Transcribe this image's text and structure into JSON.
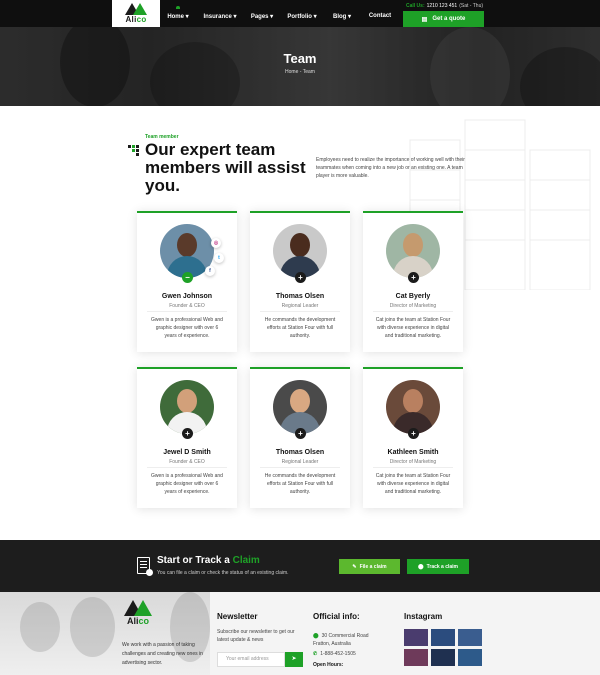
{
  "header": {
    "logo_text_a": "Ali",
    "logo_text_b": "co",
    "nav": [
      "Home",
      "Insurance",
      "Pages",
      "Portfolio",
      "Blog",
      "Contact"
    ],
    "call_label": "Call Us:",
    "call_number": "1210 123 451",
    "call_hours": "(Sat - Thu)",
    "quote_button": "Get a quote"
  },
  "hero": {
    "title": "Team",
    "breadcrumb": "Home - Team"
  },
  "intro": {
    "tag": "Team member",
    "title": "Our expert team members will assist you.",
    "description": "Employees need to realize the importance of working well with their teammates when coming into a new job or an existing one. A team player is more valuable."
  },
  "team": [
    {
      "name": "Gwen Johnson",
      "role": "Founder & CEO",
      "bio": "Gwen is a professional Web and graphic designer with over 6 years of experience."
    },
    {
      "name": "Thomas Olsen",
      "role": "Regional Leader",
      "bio": "He commands the development efforts at Station Four with full authority."
    },
    {
      "name": "Cat Byerly",
      "role": "Director of Marketing",
      "bio": "Cat joins the team at Station Four with diverse experience in digital and traditional marketing."
    },
    {
      "name": "Jewel D Smith",
      "role": "Founder & CEO",
      "bio": "Gwen is a professional Web and graphic designer with over 6 years of experience."
    },
    {
      "name": "Thomas Olsen",
      "role": "Regional Leader",
      "bio": "He commands the development efforts at Station Four with full authority."
    },
    {
      "name": "Kathleen Smith",
      "role": "Director of Marketing",
      "bio": "Cat joins the team at Station Four with diverse experience in digital and traditional marketing."
    }
  ],
  "claim": {
    "title_a": "Start or Track a",
    "title_b": "Claim",
    "subtitle": "You can file a claim or check the status of an existing claim.",
    "file_button": "File a claim",
    "track_button": "Track a claim"
  },
  "footer": {
    "about": "We work with a passion of taking challenges and creating new ones in advertising sector.",
    "newsletter_title": "Newsletter",
    "newsletter_text": "Subscribe our newsletter to get our latest update & news",
    "email_placeholder": "Your email address",
    "info_title": "Official info:",
    "address": "30 Commercial Road Fratton, Australia",
    "phone": "1-888-452-1505",
    "hours_label": "Open Hours:",
    "instagram_title": "Instagram"
  },
  "colors": {
    "accent": "#1ea127",
    "dark": "#1d1d1d"
  }
}
